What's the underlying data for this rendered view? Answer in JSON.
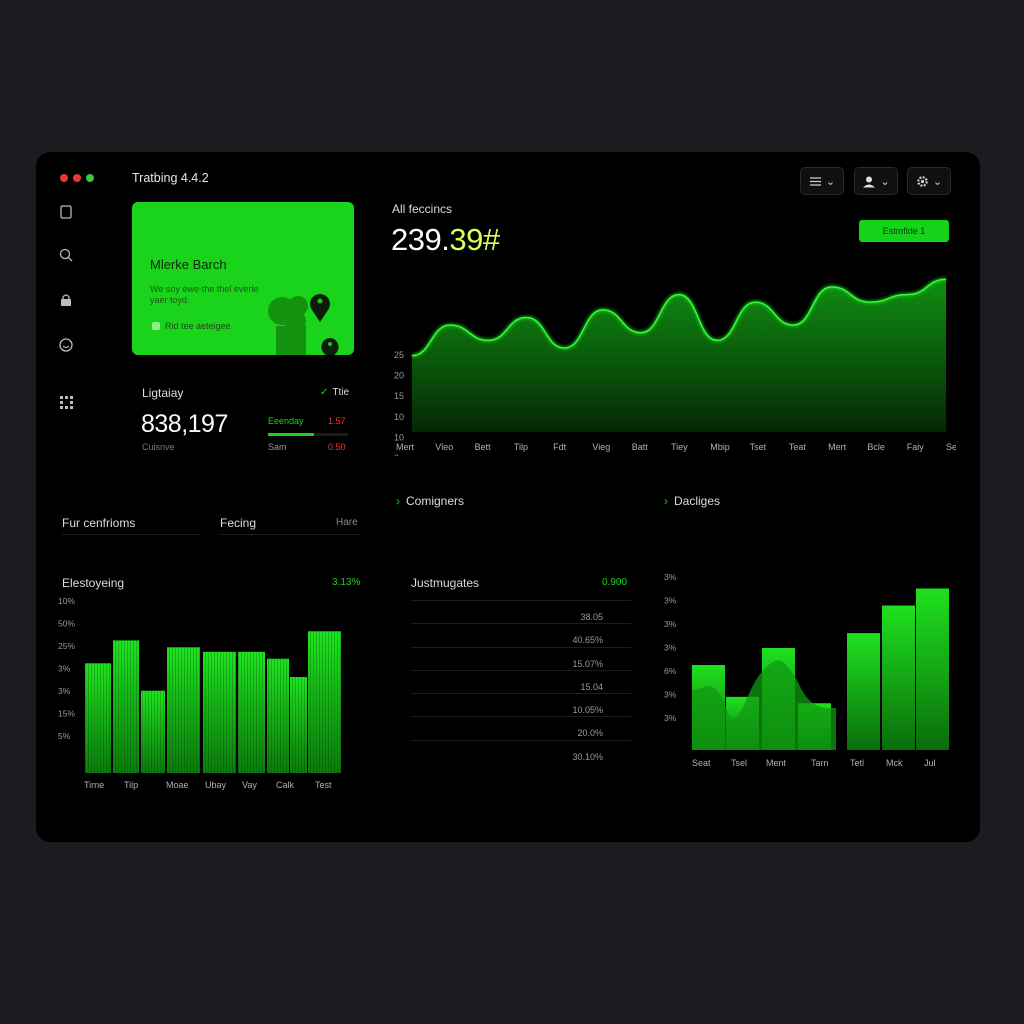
{
  "window": {
    "title": "Tratbing 4.4.2",
    "dots": [
      "#e53935",
      "#e53935",
      "#2ecc40"
    ]
  },
  "toolbar": {
    "menu_icon": "list-icon",
    "user_icon": "user-icon",
    "settings_icon": "gear-icon",
    "chevron": "⌄"
  },
  "sidebar": {
    "items": [
      {
        "icon": "document-icon"
      },
      {
        "icon": "search-icon"
      },
      {
        "icon": "lock-icon"
      },
      {
        "icon": "smile-icon"
      },
      {
        "icon": "grid-icon"
      }
    ]
  },
  "promo": {
    "title": "Mlerke Barch",
    "subtitle": "We soy ewe-the thel everle yaer toyd.",
    "cta": "Rid tee aeteigee",
    "bg": "#19d41b"
  },
  "stat": {
    "label": "Ligtaiay",
    "badge": "Ttie",
    "value": "838,197",
    "caption": "Cuisnve",
    "row1_label": "Eeenday",
    "row1_value": "1.57",
    "row2_label": "Sam",
    "row2_value": "0.50",
    "row1_progress": 0.58,
    "accent": "#19d41b",
    "negative": "#e53935"
  },
  "main_chart": {
    "label": "All feccincs",
    "value_main": "239.",
    "value_accent": "39#",
    "accent": "#d7ff5a",
    "button": "Estmfide 1",
    "chart_data": {
      "type": "area",
      "categories": [
        "Mert",
        "Vleo",
        "Bett",
        "Tilp",
        "Fdt",
        "Vieg",
        "Batt",
        "Tiey",
        "Mbip",
        "Tset",
        "Teat",
        "Mert",
        "Bcle",
        "Faiy",
        "Sest"
      ],
      "values": [
        10,
        14,
        12,
        15,
        11,
        16,
        13,
        18,
        12,
        17,
        14,
        19,
        17,
        18,
        20
      ],
      "yticks": [
        "25",
        "20",
        "15",
        "10",
        "10",
        "0"
      ],
      "series_color": "#19e21b"
    }
  },
  "sections": {
    "section_left": "Comigners",
    "section_right": "Dacliges",
    "tab_left": "Fur cenfrioms",
    "tab_mid": "Fecing",
    "tab_right": "Hare"
  },
  "bar_chart_left": {
    "title": "Elestoyeing",
    "value": "3.13%",
    "chart_data": {
      "type": "bar",
      "categories": [
        "Time",
        "Tlup",
        "Moae",
        "Maay",
        "Vay",
        "Calk",
        "Tet"
      ],
      "values": [
        48,
        58,
        36,
        55,
        53,
        53,
        50,
        42,
        62
      ],
      "category_labels": [
        "Tirne",
        "Tilp",
        "Moae",
        "Ubay",
        "Vay",
        "Calk",
        "Test"
      ],
      "yticks": [
        "10%",
        "50%",
        "25%",
        "3%",
        "3%",
        "15%",
        "5%"
      ]
    }
  },
  "list_panel": {
    "title": "Justmugates",
    "value": "0.900",
    "rows": [
      "38.05",
      "40.65%",
      "15.07%",
      "15.04",
      "10.05%",
      "20.0%",
      "30.10%"
    ]
  },
  "bar_chart_right": {
    "chart_data": {
      "type": "bar",
      "categories": [
        "Seat",
        "Tsel",
        "Ment",
        "Tarn",
        "Tetl",
        "Mck",
        "Jul"
      ],
      "values": [
        40,
        25,
        48,
        22,
        55,
        68,
        76
      ],
      "yticks": [
        "3%",
        "3%",
        "3%",
        "3%",
        "6%",
        "3%",
        "3%"
      ]
    }
  }
}
